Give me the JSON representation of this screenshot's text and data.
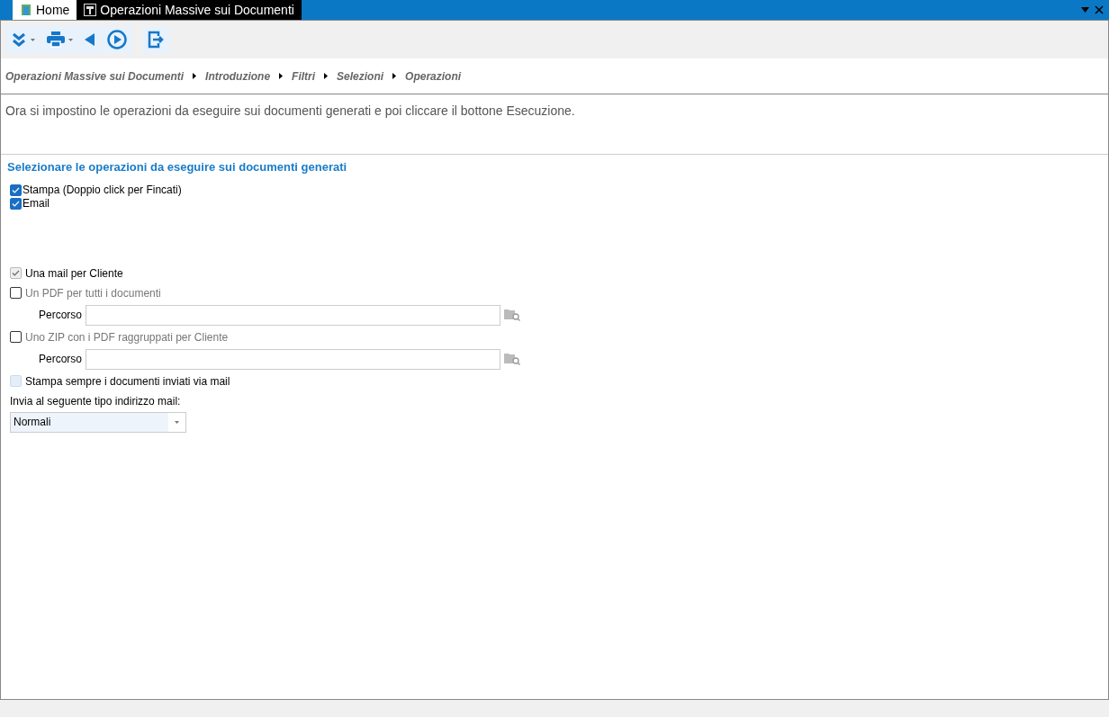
{
  "tabs": [
    {
      "label": "Home",
      "selected": false
    },
    {
      "label": "Operazioni Massive sui Documenti",
      "selected": true
    }
  ],
  "toolbar": [
    {
      "kind": "expand",
      "dropdown": true
    },
    {
      "kind": "print",
      "dropdown": true
    },
    {
      "kind": "back",
      "dropdown": false
    },
    {
      "kind": "run",
      "dropdown": false
    },
    {
      "kind": "exit",
      "dropdown": false
    }
  ],
  "breadcrumb": [
    "Operazioni Massive sui Documenti",
    "Introduzione",
    "Filtri",
    "Selezioni",
    "Operazioni"
  ],
  "intro": "Ora si impostino le operazioni da eseguire sui documenti generati e poi cliccare il bottone Esecuzione.",
  "section_title": "Selezionare le operazioni da eseguire sui documenti generati",
  "operations": [
    {
      "label": "Stampa (Doppio click per Fincati)",
      "checked": true
    },
    {
      "label": "Email",
      "checked": true
    }
  ],
  "options": [
    {
      "kind": "checkbox",
      "label": "Una mail per Cliente",
      "checked": true,
      "disabled": true,
      "greyed": false
    },
    {
      "kind": "checkbox",
      "label": "Un PDF per tutti i documenti",
      "checked": false,
      "disabled": false,
      "greyed": true
    },
    {
      "kind": "path",
      "label": "Percorso"
    },
    {
      "kind": "checkbox",
      "label": "Uno ZIP con i PDF raggruppati per Cliente",
      "checked": false,
      "disabled": false,
      "greyed": true
    },
    {
      "kind": "path",
      "label": "Percorso"
    },
    {
      "kind": "checkbox",
      "label": "Stampa sempre i documenti inviati via mail",
      "checked": false,
      "disabled": true,
      "greyed": false
    }
  ],
  "address_type": {
    "label": "Invia al seguente tipo indirizzo mail:",
    "value": "Normali"
  }
}
